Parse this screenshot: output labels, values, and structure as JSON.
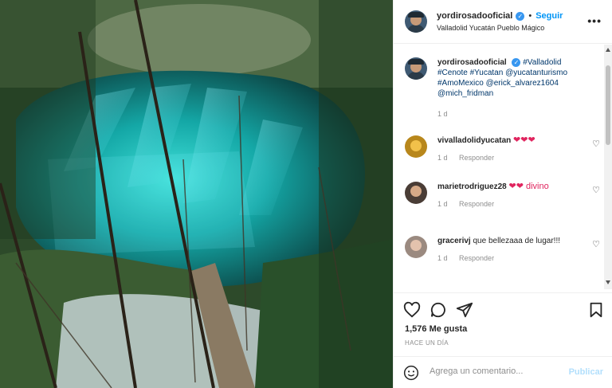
{
  "header": {
    "username": "yordirosadooficial",
    "follow_label": "Seguir",
    "location": "Valladolid Yucatán Pueblo Mágico",
    "more_label": "•••"
  },
  "caption": {
    "username": "yordirosadooficial",
    "text_tags": "#Valladolid #Cenote #Yucatan @yucatanturismo #AmoMexico @erick_alvarez1604 @mich_fridman",
    "time": "1 d"
  },
  "comments": [
    {
      "username": "vivalladolidyucatan",
      "text": "❤❤❤",
      "time": "1 d",
      "reply": "Responder"
    },
    {
      "username": "marietrodriguez28",
      "text": "❤❤ divino",
      "time": "1 d",
      "reply": "Responder"
    },
    {
      "username": "gracerivj",
      "text": "que bellezaaa de lugar!!!",
      "time": "1 d",
      "reply": "Responder"
    }
  ],
  "stats": {
    "likes": "1,576 Me gusta",
    "posted": "HACE UN DÍA"
  },
  "composer": {
    "placeholder": "Agrega un comentario...",
    "publish_label": "Publicar"
  },
  "colors": {
    "accent": "#0095f6",
    "verified": "#3897f0",
    "heart": "#e0245e",
    "water": "#1fb7b0"
  }
}
